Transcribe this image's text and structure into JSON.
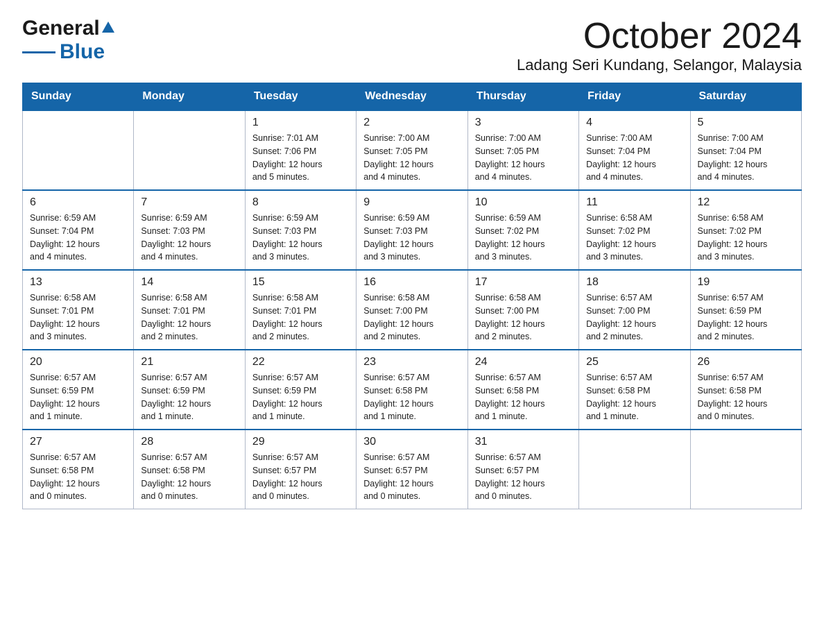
{
  "header": {
    "logo_general": "General",
    "logo_triangle": "▲",
    "logo_blue": "Blue",
    "title": "October 2024",
    "location": "Ladang Seri Kundang, Selangor, Malaysia"
  },
  "days_of_week": [
    "Sunday",
    "Monday",
    "Tuesday",
    "Wednesday",
    "Thursday",
    "Friday",
    "Saturday"
  ],
  "weeks": [
    [
      {
        "day": "",
        "info": ""
      },
      {
        "day": "",
        "info": ""
      },
      {
        "day": "1",
        "info": "Sunrise: 7:01 AM\nSunset: 7:06 PM\nDaylight: 12 hours\nand 5 minutes."
      },
      {
        "day": "2",
        "info": "Sunrise: 7:00 AM\nSunset: 7:05 PM\nDaylight: 12 hours\nand 4 minutes."
      },
      {
        "day": "3",
        "info": "Sunrise: 7:00 AM\nSunset: 7:05 PM\nDaylight: 12 hours\nand 4 minutes."
      },
      {
        "day": "4",
        "info": "Sunrise: 7:00 AM\nSunset: 7:04 PM\nDaylight: 12 hours\nand 4 minutes."
      },
      {
        "day": "5",
        "info": "Sunrise: 7:00 AM\nSunset: 7:04 PM\nDaylight: 12 hours\nand 4 minutes."
      }
    ],
    [
      {
        "day": "6",
        "info": "Sunrise: 6:59 AM\nSunset: 7:04 PM\nDaylight: 12 hours\nand 4 minutes."
      },
      {
        "day": "7",
        "info": "Sunrise: 6:59 AM\nSunset: 7:03 PM\nDaylight: 12 hours\nand 4 minutes."
      },
      {
        "day": "8",
        "info": "Sunrise: 6:59 AM\nSunset: 7:03 PM\nDaylight: 12 hours\nand 3 minutes."
      },
      {
        "day": "9",
        "info": "Sunrise: 6:59 AM\nSunset: 7:03 PM\nDaylight: 12 hours\nand 3 minutes."
      },
      {
        "day": "10",
        "info": "Sunrise: 6:59 AM\nSunset: 7:02 PM\nDaylight: 12 hours\nand 3 minutes."
      },
      {
        "day": "11",
        "info": "Sunrise: 6:58 AM\nSunset: 7:02 PM\nDaylight: 12 hours\nand 3 minutes."
      },
      {
        "day": "12",
        "info": "Sunrise: 6:58 AM\nSunset: 7:02 PM\nDaylight: 12 hours\nand 3 minutes."
      }
    ],
    [
      {
        "day": "13",
        "info": "Sunrise: 6:58 AM\nSunset: 7:01 PM\nDaylight: 12 hours\nand 3 minutes."
      },
      {
        "day": "14",
        "info": "Sunrise: 6:58 AM\nSunset: 7:01 PM\nDaylight: 12 hours\nand 2 minutes."
      },
      {
        "day": "15",
        "info": "Sunrise: 6:58 AM\nSunset: 7:01 PM\nDaylight: 12 hours\nand 2 minutes."
      },
      {
        "day": "16",
        "info": "Sunrise: 6:58 AM\nSunset: 7:00 PM\nDaylight: 12 hours\nand 2 minutes."
      },
      {
        "day": "17",
        "info": "Sunrise: 6:58 AM\nSunset: 7:00 PM\nDaylight: 12 hours\nand 2 minutes."
      },
      {
        "day": "18",
        "info": "Sunrise: 6:57 AM\nSunset: 7:00 PM\nDaylight: 12 hours\nand 2 minutes."
      },
      {
        "day": "19",
        "info": "Sunrise: 6:57 AM\nSunset: 6:59 PM\nDaylight: 12 hours\nand 2 minutes."
      }
    ],
    [
      {
        "day": "20",
        "info": "Sunrise: 6:57 AM\nSunset: 6:59 PM\nDaylight: 12 hours\nand 1 minute."
      },
      {
        "day": "21",
        "info": "Sunrise: 6:57 AM\nSunset: 6:59 PM\nDaylight: 12 hours\nand 1 minute."
      },
      {
        "day": "22",
        "info": "Sunrise: 6:57 AM\nSunset: 6:59 PM\nDaylight: 12 hours\nand 1 minute."
      },
      {
        "day": "23",
        "info": "Sunrise: 6:57 AM\nSunset: 6:58 PM\nDaylight: 12 hours\nand 1 minute."
      },
      {
        "day": "24",
        "info": "Sunrise: 6:57 AM\nSunset: 6:58 PM\nDaylight: 12 hours\nand 1 minute."
      },
      {
        "day": "25",
        "info": "Sunrise: 6:57 AM\nSunset: 6:58 PM\nDaylight: 12 hours\nand 1 minute."
      },
      {
        "day": "26",
        "info": "Sunrise: 6:57 AM\nSunset: 6:58 PM\nDaylight: 12 hours\nand 0 minutes."
      }
    ],
    [
      {
        "day": "27",
        "info": "Sunrise: 6:57 AM\nSunset: 6:58 PM\nDaylight: 12 hours\nand 0 minutes."
      },
      {
        "day": "28",
        "info": "Sunrise: 6:57 AM\nSunset: 6:58 PM\nDaylight: 12 hours\nand 0 minutes."
      },
      {
        "day": "29",
        "info": "Sunrise: 6:57 AM\nSunset: 6:57 PM\nDaylight: 12 hours\nand 0 minutes."
      },
      {
        "day": "30",
        "info": "Sunrise: 6:57 AM\nSunset: 6:57 PM\nDaylight: 12 hours\nand 0 minutes."
      },
      {
        "day": "31",
        "info": "Sunrise: 6:57 AM\nSunset: 6:57 PM\nDaylight: 12 hours\nand 0 minutes."
      },
      {
        "day": "",
        "info": ""
      },
      {
        "day": "",
        "info": ""
      }
    ]
  ]
}
